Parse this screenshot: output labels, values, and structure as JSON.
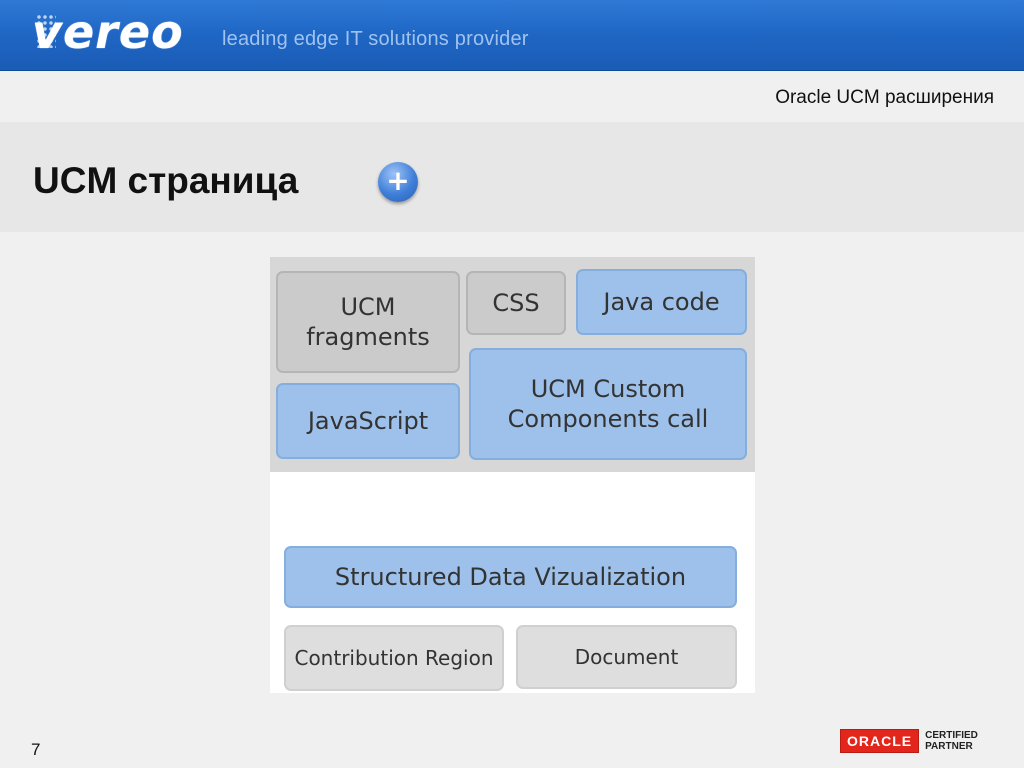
{
  "header": {
    "logo_text": "vereo",
    "tagline": "leading edge IT solutions provider"
  },
  "subtitle": "Oracle UCM расширения",
  "title": "UCM страница",
  "plus_label": "+",
  "diagram": {
    "ucm_fragments": "UCM fragments",
    "css": "CSS",
    "java_code": "Java code",
    "javascript": "JavaScript",
    "ucm_custom_components": "UCM Custom Components call",
    "structured_data": "Structured Data Vizualization",
    "contribution_region": "Contribution Region",
    "document": "Document"
  },
  "footer": {
    "page_number": "7",
    "oracle_logo": "ORACLE",
    "certified": "CERTIFIED",
    "partner": "PARTNER"
  },
  "colors": {
    "banner": "#1f66c4",
    "blue_box": "#9dc1ea",
    "gray_box": "#cbcbcb",
    "oracle_red": "#e3261c"
  }
}
